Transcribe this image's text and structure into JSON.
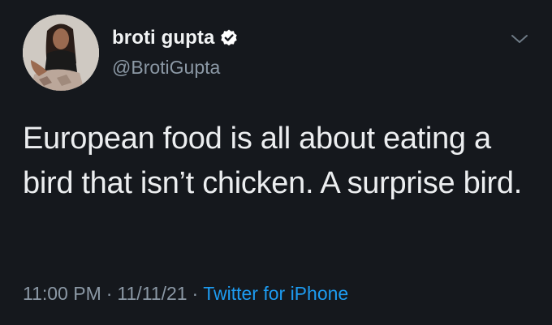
{
  "author": {
    "display_name": "broti gupta",
    "handle": "@BrotiGupta",
    "verified_icon": "verified-badge-icon"
  },
  "menu": {
    "icon": "chevron-down-icon"
  },
  "tweet": {
    "text": "European food is all about eating a bird that isn’t chicken. A surprise bird."
  },
  "meta": {
    "time": "11:00 PM",
    "date": "11/11/21",
    "separator": "·",
    "source": "Twitter for iPhone"
  },
  "colors": {
    "background": "#15181d",
    "text": "#e7e9ea",
    "secondary": "#8b98a5",
    "accent": "#1d9bf0"
  }
}
